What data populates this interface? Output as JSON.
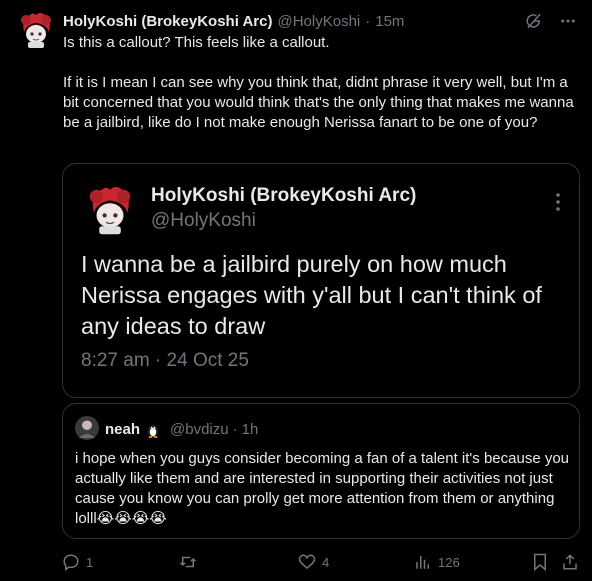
{
  "tweet": {
    "author_name": "HolyKoshi (BrokeyKoshi Arc)",
    "handle": "@HolyKoshi",
    "separator": "·",
    "time": "15m",
    "text": "Is this a callout? This feels like a callout.\n\nIf it is I mean I can see why you think that, didnt phrase it very well, but I'm a bit concerned that you would think that's the only thing that makes me wanna be a jailbird, like do I not make enough Nerissa fanart to be one of you?"
  },
  "quoted": {
    "author_name": "HolyKoshi (BrokeyKoshi Arc)",
    "handle": "@HolyKoshi",
    "text": "I wanna be a jailbird purely on how much Nerissa engages with y'all but I can't think of any ideas to draw",
    "date": "8:27 am · 24 Oct 25"
  },
  "quoted_reply": {
    "author_name": "neah",
    "handle": "@bvdizu",
    "separator": "·",
    "time": "1h",
    "text": "i hope when you guys consider becoming a fan of a talent it's because you actually like them and are  interested in supporting their activities not just cause you know you can prolly get more attention from them or anything lolll😭😭😭😭"
  },
  "actions": {
    "reply_count": "1",
    "retweet_count": "",
    "like_count": "4",
    "view_count": "126"
  },
  "icons": {
    "header": [
      "grok-icon",
      "more-icon"
    ],
    "actions": [
      "reply-icon",
      "retweet-icon",
      "like-icon",
      "views-icon",
      "bookmark-icon",
      "share-icon"
    ]
  },
  "colors": {
    "background": "#000000",
    "text": "#e7e9ea",
    "muted": "#71767b",
    "border": "#2f3336",
    "avatar_red": "#c8282e"
  }
}
